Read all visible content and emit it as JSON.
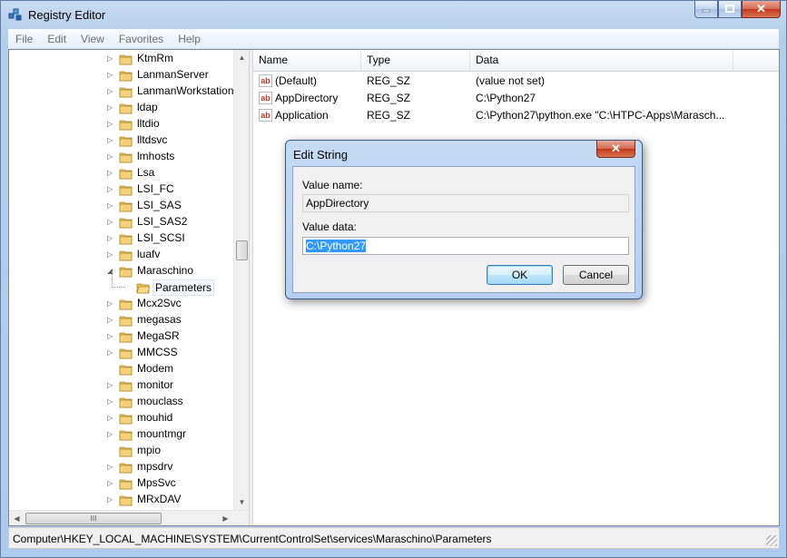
{
  "window": {
    "title": "Registry Editor"
  },
  "menu": [
    "File",
    "Edit",
    "View",
    "Favorites",
    "Help"
  ],
  "tree": {
    "items": [
      {
        "label": "KtmRm",
        "expander": "closed"
      },
      {
        "label": "LanmanServer",
        "expander": "closed"
      },
      {
        "label": "LanmanWorkstation",
        "expander": "closed"
      },
      {
        "label": "ldap",
        "expander": "closed"
      },
      {
        "label": "lltdio",
        "expander": "closed"
      },
      {
        "label": "lltdsvc",
        "expander": "closed"
      },
      {
        "label": "lmhosts",
        "expander": "closed"
      },
      {
        "label": "Lsa",
        "expander": "closed"
      },
      {
        "label": "LSI_FC",
        "expander": "closed"
      },
      {
        "label": "LSI_SAS",
        "expander": "closed"
      },
      {
        "label": "LSI_SAS2",
        "expander": "closed"
      },
      {
        "label": "LSI_SCSI",
        "expander": "closed"
      },
      {
        "label": "luafv",
        "expander": "closed"
      },
      {
        "label": "Maraschino",
        "expander": "open"
      },
      {
        "label": "Parameters",
        "expander": "none",
        "child": true,
        "selected": true
      },
      {
        "label": "Mcx2Svc",
        "expander": "closed"
      },
      {
        "label": "megasas",
        "expander": "closed"
      },
      {
        "label": "MegaSR",
        "expander": "closed"
      },
      {
        "label": "MMCSS",
        "expander": "closed"
      },
      {
        "label": "Modem",
        "expander": "none"
      },
      {
        "label": "monitor",
        "expander": "closed"
      },
      {
        "label": "mouclass",
        "expander": "closed"
      },
      {
        "label": "mouhid",
        "expander": "closed"
      },
      {
        "label": "mountmgr",
        "expander": "closed"
      },
      {
        "label": "mpio",
        "expander": "none"
      },
      {
        "label": "mpsdrv",
        "expander": "closed"
      },
      {
        "label": "MpsSvc",
        "expander": "closed"
      },
      {
        "label": "MRxDAV",
        "expander": "closed"
      }
    ],
    "hscroll_grip": "III"
  },
  "list": {
    "columns": [
      "Name",
      "Type",
      "Data"
    ],
    "rows": [
      {
        "name": "(Default)",
        "type": "REG_SZ",
        "data": "(value not set)",
        "icon": "ab-string-icon"
      },
      {
        "name": "AppDirectory",
        "type": "REG_SZ",
        "data": "C:\\Python27",
        "icon": "ab-string-icon"
      },
      {
        "name": "Application",
        "type": "REG_SZ",
        "data": "C:\\Python27\\python.exe \"C:\\HTPC-Apps\\Marasch...",
        "icon": "ab-string-icon"
      }
    ]
  },
  "status": {
    "path": "Computer\\HKEY_LOCAL_MACHINE\\SYSTEM\\CurrentControlSet\\services\\Maraschino\\Parameters"
  },
  "dialog": {
    "title": "Edit String",
    "value_name_label": "Value name:",
    "value_name": "AppDirectory",
    "value_data_label": "Value data:",
    "value_data": "C:\\Python27",
    "ok_label": "OK",
    "cancel_label": "Cancel"
  },
  "colors": {
    "folder": "#e8c35a",
    "selection": "#3399ff",
    "title_gradient": "#c9dcf2"
  }
}
